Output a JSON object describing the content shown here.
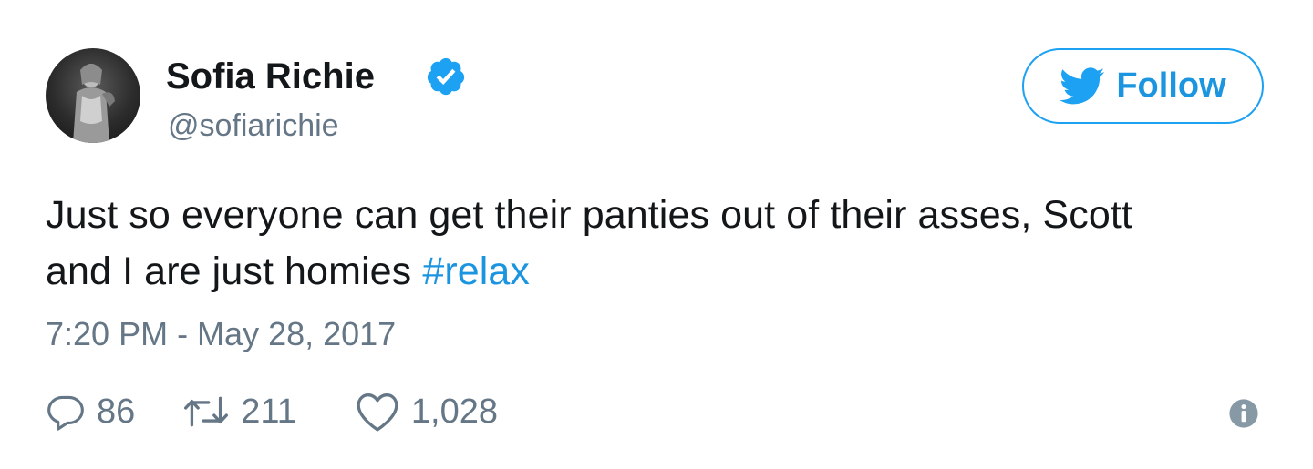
{
  "author": {
    "display_name": "Sofia Richie",
    "handle": "@sofiarichie",
    "verified": true,
    "avatar_icon": "avatar-photo"
  },
  "follow_button": {
    "label": "Follow",
    "icon": "twitter-bird-icon",
    "color": "#1da1f2"
  },
  "tweet": {
    "text_line_1": "Just so everyone can get their panties out of their asses, Scott",
    "text_line_2": "and I are just homies ",
    "hashtag": "#relax",
    "timestamp": "7:20 PM - May 28, 2017"
  },
  "actions": {
    "replies": "86",
    "retweets": "211",
    "likes": "1,028",
    "reply_icon": "reply-icon",
    "retweet_icon": "retweet-icon",
    "like_icon": "heart-icon",
    "info_icon": "info-icon"
  },
  "colors": {
    "text": "#14171a",
    "secondary": "#657786",
    "link": "#1b95e0",
    "brand": "#1da1f2"
  }
}
